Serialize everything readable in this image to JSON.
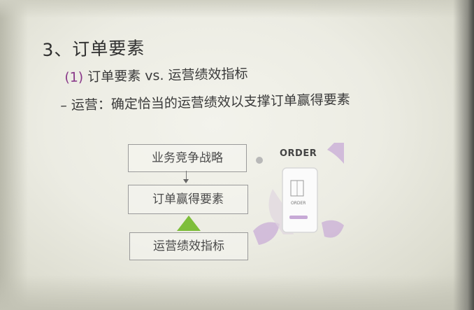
{
  "slide": {
    "title": "3、订单要素",
    "subtitle_paren": "(1)",
    "subtitle_text": " 订单要素 vs. 运营绩效指标",
    "point": "– 运营：确定恰当的运营绩效以支撑订单赢得要素"
  },
  "flow": {
    "box1": "业务竞争战略",
    "box2": "订单赢得要素",
    "box3": "运营绩效指标"
  },
  "illustration": {
    "order_label": "ORDER",
    "phone_label": "ORDER",
    "accent_purple": "#c7a9d6",
    "accent_green": "#7ebe3a"
  }
}
